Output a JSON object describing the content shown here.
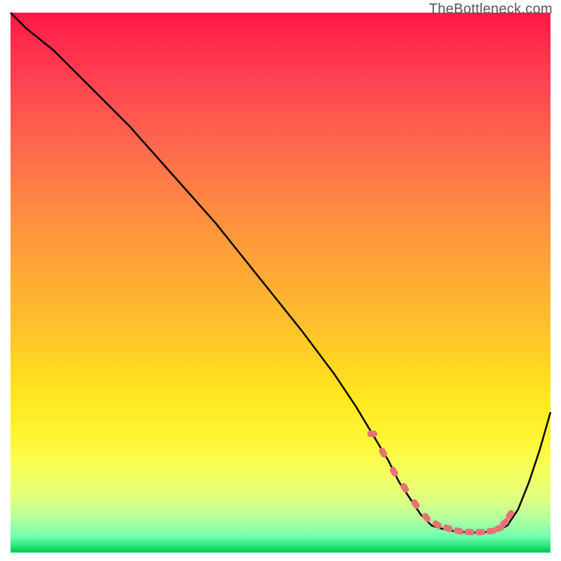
{
  "watermark": "TheBottleneck.com",
  "chart_data": {
    "type": "line",
    "title": "",
    "xlabel": "",
    "ylabel": "",
    "xlim": [
      0,
      100
    ],
    "ylim": [
      0,
      100
    ],
    "series": [
      {
        "name": "bottleneck-curve",
        "x": [
          0,
          3,
          8,
          15,
          22,
          30,
          38,
          46,
          54,
          60,
          64,
          67,
          70,
          72,
          74,
          76,
          78,
          80,
          82,
          84,
          86,
          88,
          90,
          92,
          94,
          96,
          98,
          100
        ],
        "values": [
          100,
          97,
          93,
          86,
          79,
          70,
          61,
          51,
          41,
          33,
          27,
          22,
          17,
          13,
          10,
          7,
          5,
          4.4,
          4,
          3.8,
          3.7,
          3.8,
          4,
          5,
          8,
          13,
          19,
          26
        ]
      }
    ],
    "dotted_segment": {
      "name": "highlight-dots",
      "x": [
        67,
        69,
        71,
        73,
        75,
        77,
        79,
        81,
        83,
        85,
        87,
        89,
        90.5,
        91.5,
        92.5
      ],
      "values": [
        22,
        18.5,
        15,
        12,
        9,
        6.5,
        5.2,
        4.5,
        4.0,
        3.8,
        3.8,
        4.0,
        4.5,
        5.5,
        7.0
      ]
    },
    "dot_color": "#e57373",
    "curve_color": "#000000"
  }
}
